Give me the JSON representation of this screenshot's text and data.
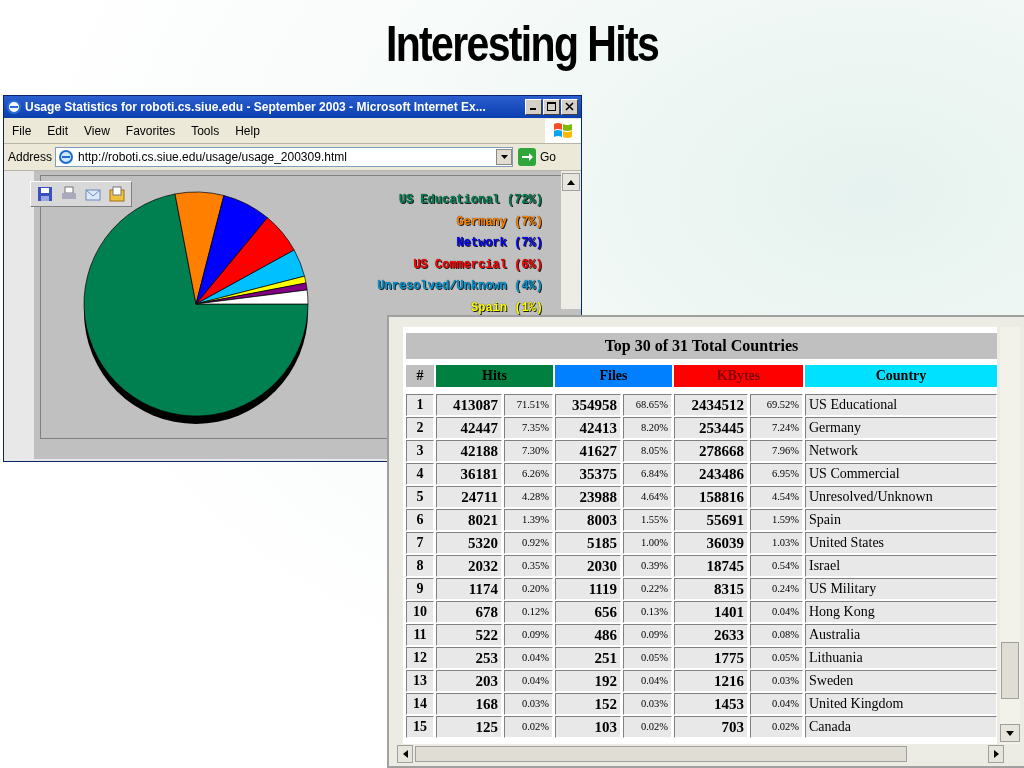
{
  "slide_title": "Interesting Hits",
  "browser": {
    "title": "Usage Statistics for roboti.cs.siue.edu - September 2003 - Microsoft Internet Ex...",
    "menu": [
      "File",
      "Edit",
      "View",
      "Favorites",
      "Tools",
      "Help"
    ],
    "address_label": "Address",
    "url": "http://roboti.cs.siue.edu/usage/usage_200309.html",
    "go": "Go",
    "chart_data": {
      "type": "pie",
      "values": [
        72,
        7,
        7,
        6,
        4,
        1,
        1,
        2
      ],
      "colors": [
        "#008050",
        "#ff8000",
        "#0000ff",
        "#ff0000",
        "#00c0ff",
        "#ffff00",
        "#800080",
        "#ffffff"
      ]
    },
    "legend": [
      {
        "label": "US Educational (72%)",
        "color": "#008050"
      },
      {
        "label": "Germany (7%)",
        "color": "#ff8000"
      },
      {
        "label": "Network (7%)",
        "color": "#0000ff"
      },
      {
        "label": "US Commercial (6%)",
        "color": "#ff0000"
      },
      {
        "label": "Unresolved/Unknown (4%)",
        "color": "#0096d6"
      },
      {
        "label": "Spain (1%)",
        "color": "#ffff00"
      }
    ]
  },
  "stats_window": {
    "table": {
      "title": "Top 30 of 31 Total Countries",
      "header_groups": [
        {
          "label": "#",
          "color": "#c0c0c0"
        },
        {
          "label": "Hits",
          "color": "#008040"
        },
        {
          "label": "Files",
          "color": "#0080ff"
        },
        {
          "label": "KBytes",
          "color": "#ff0000"
        },
        {
          "label": "Country",
          "color": "#00e0ff"
        }
      ],
      "rows": [
        {
          "index": "1",
          "hits": "413087",
          "hits_pct": "71.51%",
          "files": "354958",
          "files_pct": "68.65%",
          "kbytes": "2434512",
          "kbytes_pct": "69.52%",
          "country": "US Educational"
        },
        {
          "index": "2",
          "hits": "42447",
          "hits_pct": "7.35%",
          "files": "42413",
          "files_pct": "8.20%",
          "kbytes": "253445",
          "kbytes_pct": "7.24%",
          "country": "Germany"
        },
        {
          "index": "3",
          "hits": "42188",
          "hits_pct": "7.30%",
          "files": "41627",
          "files_pct": "8.05%",
          "kbytes": "278668",
          "kbytes_pct": "7.96%",
          "country": "Network"
        },
        {
          "index": "4",
          "hits": "36181",
          "hits_pct": "6.26%",
          "files": "35375",
          "files_pct": "6.84%",
          "kbytes": "243486",
          "kbytes_pct": "6.95%",
          "country": "US Commercial"
        },
        {
          "index": "5",
          "hits": "24711",
          "hits_pct": "4.28%",
          "files": "23988",
          "files_pct": "4.64%",
          "kbytes": "158816",
          "kbytes_pct": "4.54%",
          "country": "Unresolved/Unknown"
        },
        {
          "index": "6",
          "hits": "8021",
          "hits_pct": "1.39%",
          "files": "8003",
          "files_pct": "1.55%",
          "kbytes": "55691",
          "kbytes_pct": "1.59%",
          "country": "Spain"
        },
        {
          "index": "7",
          "hits": "5320",
          "hits_pct": "0.92%",
          "files": "5185",
          "files_pct": "1.00%",
          "kbytes": "36039",
          "kbytes_pct": "1.03%",
          "country": "United States"
        },
        {
          "index": "8",
          "hits": "2032",
          "hits_pct": "0.35%",
          "files": "2030",
          "files_pct": "0.39%",
          "kbytes": "18745",
          "kbytes_pct": "0.54%",
          "country": "Israel"
        },
        {
          "index": "9",
          "hits": "1174",
          "hits_pct": "0.20%",
          "files": "1119",
          "files_pct": "0.22%",
          "kbytes": "8315",
          "kbytes_pct": "0.24%",
          "country": "US Military"
        },
        {
          "index": "10",
          "hits": "678",
          "hits_pct": "0.12%",
          "files": "656",
          "files_pct": "0.13%",
          "kbytes": "1401",
          "kbytes_pct": "0.04%",
          "country": "Hong Kong"
        },
        {
          "index": "11",
          "hits": "522",
          "hits_pct": "0.09%",
          "files": "486",
          "files_pct": "0.09%",
          "kbytes": "2633",
          "kbytes_pct": "0.08%",
          "country": "Australia"
        },
        {
          "index": "12",
          "hits": "253",
          "hits_pct": "0.04%",
          "files": "251",
          "files_pct": "0.05%",
          "kbytes": "1775",
          "kbytes_pct": "0.05%",
          "country": "Lithuania"
        },
        {
          "index": "13",
          "hits": "203",
          "hits_pct": "0.04%",
          "files": "192",
          "files_pct": "0.04%",
          "kbytes": "1216",
          "kbytes_pct": "0.03%",
          "country": "Sweden"
        },
        {
          "index": "14",
          "hits": "168",
          "hits_pct": "0.03%",
          "files": "152",
          "files_pct": "0.03%",
          "kbytes": "1453",
          "kbytes_pct": "0.04%",
          "country": "United Kingdom"
        },
        {
          "index": "15",
          "hits": "125",
          "hits_pct": "0.02%",
          "files": "103",
          "files_pct": "0.02%",
          "kbytes": "703",
          "kbytes_pct": "0.02%",
          "country": "Canada"
        }
      ]
    }
  }
}
